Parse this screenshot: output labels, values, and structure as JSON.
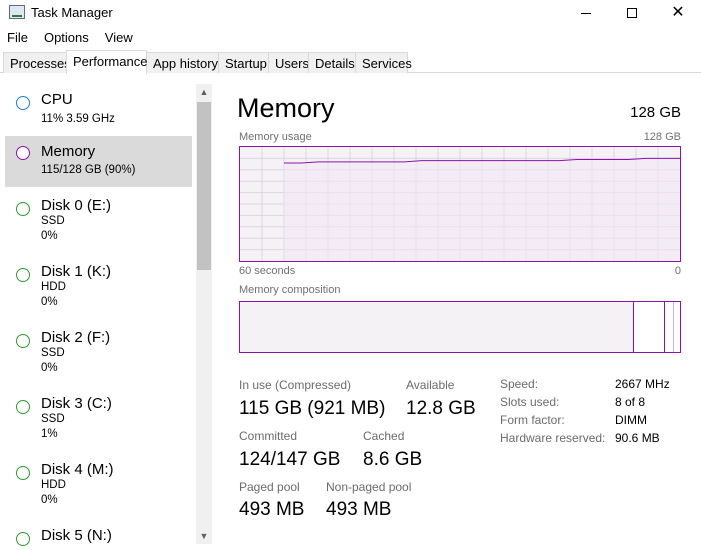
{
  "window": {
    "title": "Task Manager"
  },
  "menu": [
    "File",
    "Options",
    "View"
  ],
  "tabs": [
    "Processes",
    "Performance",
    "App history",
    "Startup",
    "Users",
    "Details",
    "Services"
  ],
  "active_tab": "Performance",
  "resources": [
    {
      "name": "CPU",
      "line1": "11%  3.59 GHz",
      "line2": "",
      "kind": "cpu"
    },
    {
      "name": "Memory",
      "line1": "115/128 GB (90%)",
      "line2": "",
      "kind": "mem"
    },
    {
      "name": "Disk 0 (E:)",
      "line1": "SSD",
      "line2": "0%",
      "kind": "disk"
    },
    {
      "name": "Disk 1 (K:)",
      "line1": "HDD",
      "line2": "0%",
      "kind": "disk"
    },
    {
      "name": "Disk 2 (F:)",
      "line1": "SSD",
      "line2": "0%",
      "kind": "disk"
    },
    {
      "name": "Disk 3 (C:)",
      "line1": "SSD",
      "line2": "1%",
      "kind": "disk"
    },
    {
      "name": "Disk 4 (M:)",
      "line1": "HDD",
      "line2": "0%",
      "kind": "disk"
    },
    {
      "name": "Disk 5 (N:)",
      "line1": "",
      "line2": "",
      "kind": "disk"
    }
  ],
  "detail": {
    "title": "Memory",
    "total": "128 GB",
    "usage_label": "Memory usage",
    "usage_max": "128 GB",
    "time_left": "60 seconds",
    "time_right": "0",
    "composition_label": "Memory composition",
    "composition": {
      "in_use_fraction": 0.9,
      "modified_fraction": 0.07,
      "standby_fraction": 0.02
    },
    "usage_history_fraction": [
      0.86,
      0.86,
      0.87,
      0.87,
      0.87,
      0.87,
      0.87,
      0.87,
      0.88,
      0.88,
      0.88,
      0.88,
      0.88,
      0.88,
      0.88,
      0.88,
      0.88,
      0.89,
      0.89,
      0.89,
      0.89,
      0.9,
      0.9,
      0.9
    ],
    "stats": {
      "in_use_label": "In use (Compressed)",
      "in_use_value": "115 GB (921 MB)",
      "available_label": "Available",
      "available_value": "12.8 GB",
      "committed_label": "Committed",
      "committed_value": "124/147 GB",
      "cached_label": "Cached",
      "cached_value": "8.6 GB",
      "paged_label": "Paged pool",
      "paged_value": "493 MB",
      "nonpaged_label": "Non-paged pool",
      "nonpaged_value": "493 MB"
    },
    "specs": [
      {
        "label": "Speed:",
        "value": "2667 MHz"
      },
      {
        "label": "Slots used:",
        "value": "8 of 8"
      },
      {
        "label": "Form factor:",
        "value": "DIMM"
      },
      {
        "label": "Hardware reserved:",
        "value": "90.6 MB"
      }
    ]
  },
  "colors": {
    "memory_accent": "#8b12ae",
    "cpu_accent": "#1a7ecf",
    "disk_accent": "#2e9c2e",
    "selected_bg": "#dadada",
    "graph_fill": "#f4f2f4"
  }
}
